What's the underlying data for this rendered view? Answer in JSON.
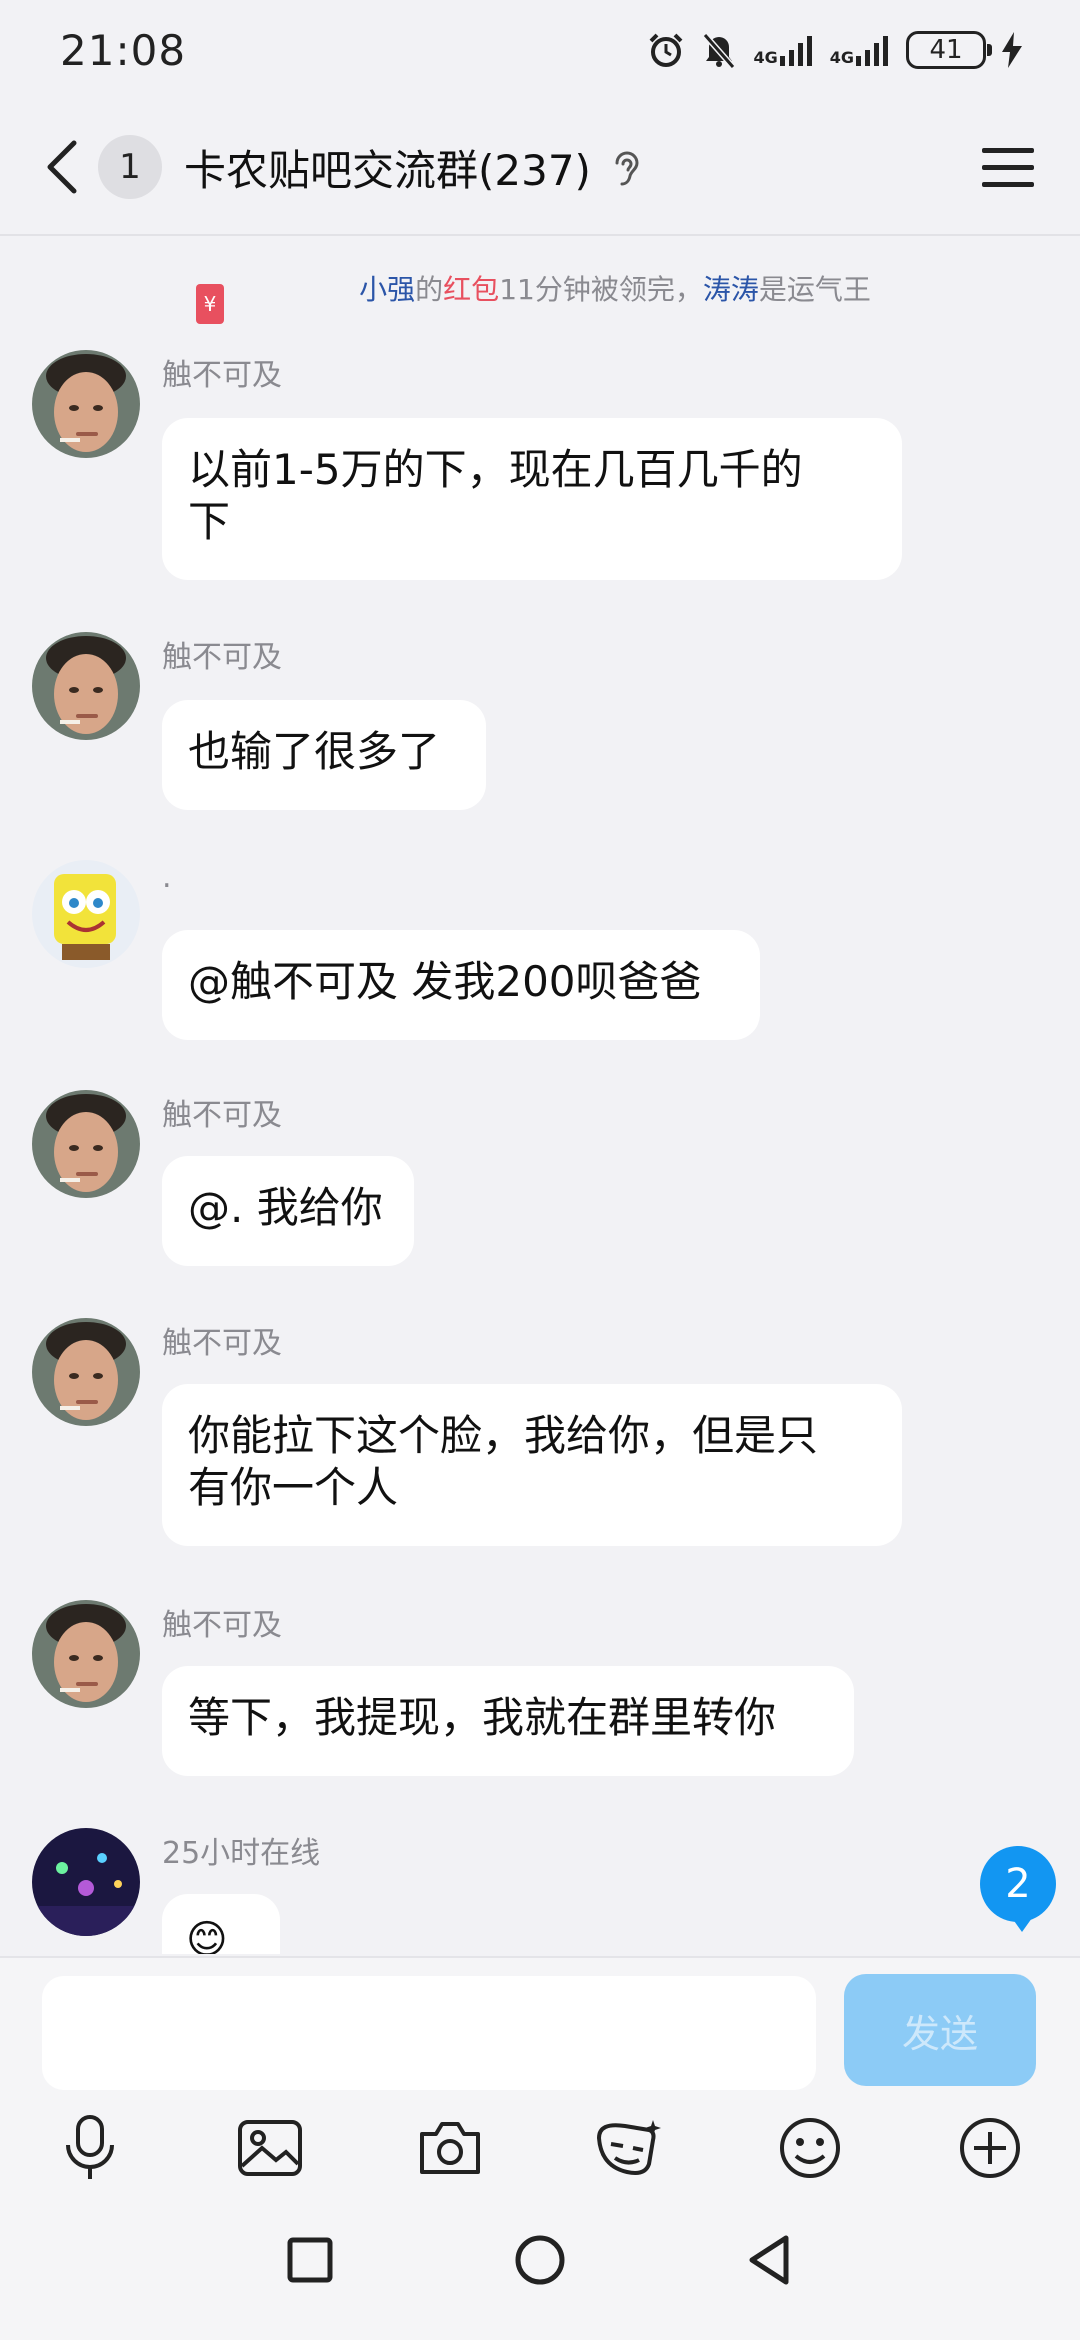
{
  "status_bar": {
    "time": "21:08",
    "network_1": "4G",
    "network_2": "4G",
    "battery": "41"
  },
  "header": {
    "unread_count": "1",
    "title": "卡农贴吧交流群(237)"
  },
  "system_notice": {
    "part1": "小强",
    "part2": "的",
    "part3": "红包",
    "part4": "11分钟被领完，",
    "part5": "涛涛",
    "part6": "是运气王",
    "icon_symbol": "¥"
  },
  "messages": [
    {
      "sender": "触不可及",
      "text_line1": "以前1-5万的下，现在几百几千的",
      "text_line2": "下"
    },
    {
      "sender": "触不可及",
      "text": "也输了很多了"
    },
    {
      "sender": ".",
      "text": "@触不可及 发我200呗爸爸"
    },
    {
      "sender": "触不可及",
      "text": "@. 我给你"
    },
    {
      "sender": "触不可及",
      "text_line1": "你能拉下这个脸，我给你，但是只",
      "text_line2": "有你一个人"
    },
    {
      "sender": "触不可及",
      "text": "等下，我提现，我就在群里转你"
    },
    {
      "sender": "25小时在线",
      "text": "😊"
    }
  ],
  "new_message_badge": "2",
  "input": {
    "value": "",
    "send_label": "发送"
  },
  "toolbar_icons": [
    "microphone-icon",
    "image-icon",
    "camera-icon",
    "sticker-icon",
    "emoji-icon",
    "plus-icon"
  ],
  "colors": {
    "background": "#f2f2f5",
    "accent": "#1296f2",
    "send_disabled": "#8ccbf6",
    "redpacket": "#e8505f",
    "name_link": "#2b55a8"
  }
}
